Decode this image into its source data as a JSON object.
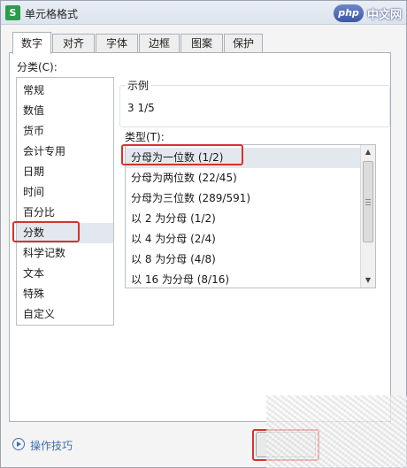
{
  "window": {
    "title": "单元格格式",
    "app_icon": "S"
  },
  "watermark": {
    "badge": "php",
    "text": "中文网"
  },
  "tabs": [
    {
      "label": "数字",
      "active": true
    },
    {
      "label": "对齐"
    },
    {
      "label": "字体"
    },
    {
      "label": "边框"
    },
    {
      "label": "图案"
    },
    {
      "label": "保护"
    }
  ],
  "category": {
    "label": "分类(C):",
    "items": [
      "常规",
      "数值",
      "货币",
      "会计专用",
      "日期",
      "时间",
      "百分比",
      "分数",
      "科学记数",
      "文本",
      "特殊",
      "自定义"
    ],
    "selected": "分数"
  },
  "sample": {
    "label": "示例",
    "value": "3 1/5"
  },
  "type": {
    "label": "类型(T):",
    "items": [
      "分母为一位数 (1/2)",
      "分母为两位数 (22/45)",
      "分母为三位数 (289/591)",
      "以 2 为分母 (1/2)",
      "以 4 为分母 (2/4)",
      "以 8 为分母 (4/8)",
      "以 16 为分母 (8/16)"
    ],
    "selected": "分母为一位数 (1/2)"
  },
  "footer": {
    "help_text": "操作技巧"
  },
  "colors": {
    "highlight": "#d6322d",
    "selection": "#e3e8ef",
    "link": "#3b6fb0",
    "app_icon": "#2a9d4a"
  },
  "icons": {
    "help": "play-circle-icon",
    "scroll_up": "arrow-up-icon",
    "scroll_down": "arrow-down-icon"
  }
}
